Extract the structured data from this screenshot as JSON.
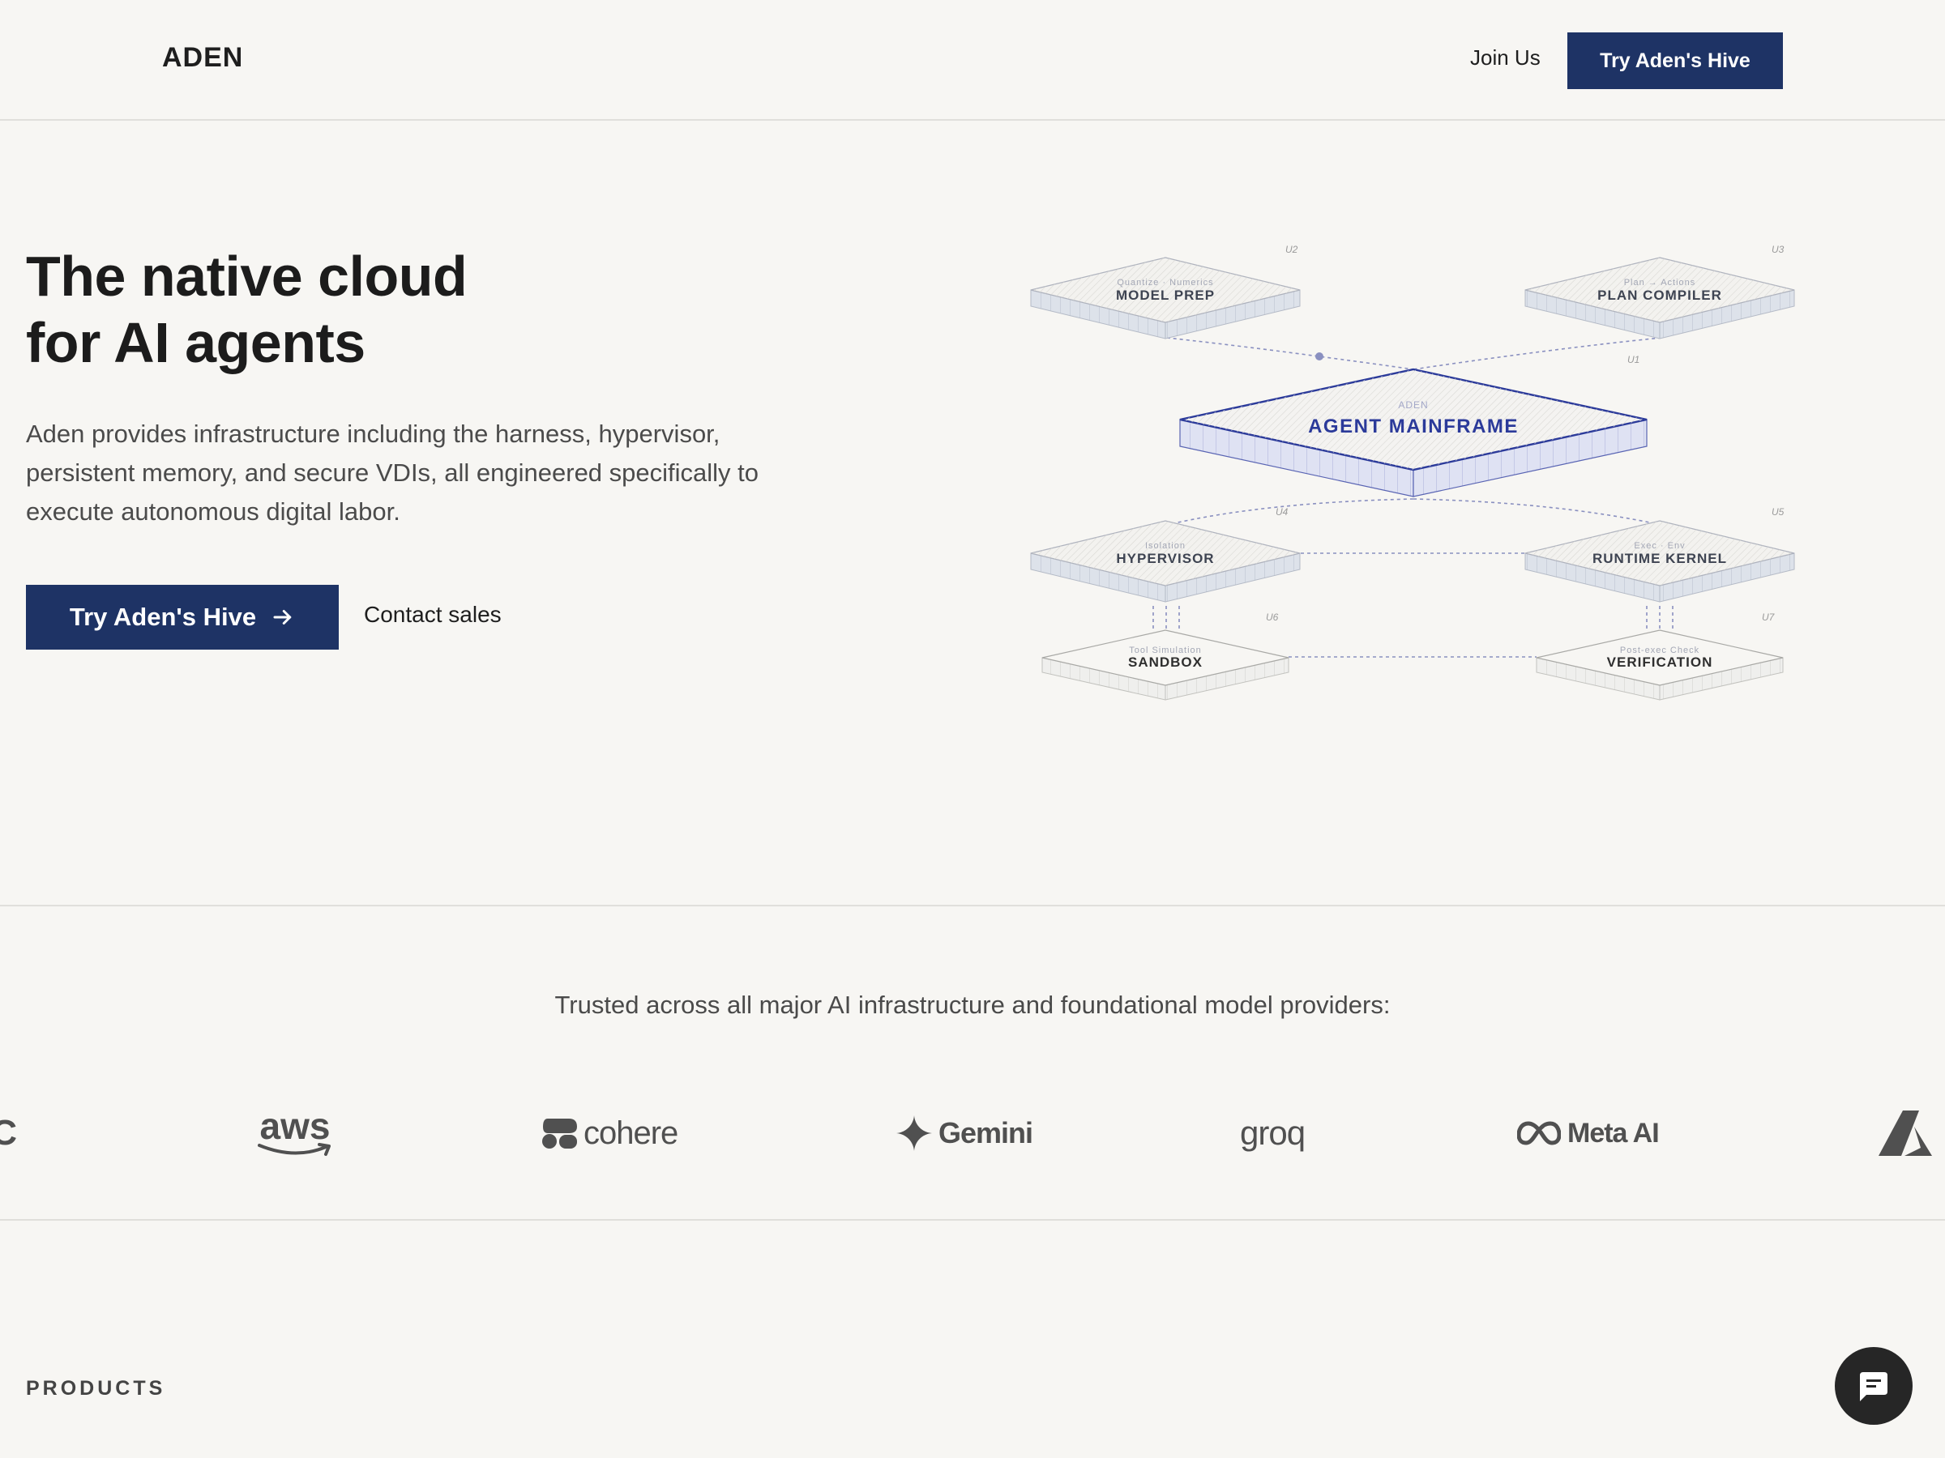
{
  "header": {
    "logo": "ADEN",
    "join_label": "Join Us",
    "cta_label": "Try Aden's Hive"
  },
  "hero": {
    "title_line1": "The native cloud",
    "title_line2": "for AI agents",
    "description": "Aden provides infrastructure including the harness, hypervisor, persistent memory, and secure VDIs, all engineered specifically to execute autonomous digital labor.",
    "cta_label": "Try Aden's Hive",
    "contact_label": "Contact sales"
  },
  "diagram": {
    "mainframe": {
      "tag": "ADEN",
      "label": "AGENT MAINFRAME",
      "unit": "U1"
    },
    "model_prep": {
      "tag": "Quantize · Numerics",
      "label": "MODEL PREP",
      "unit": "U2"
    },
    "plan_compiler": {
      "tag": "Plan → Actions",
      "label": "PLAN COMPILER",
      "unit": "U3"
    },
    "hypervisor": {
      "tag": "Isolation",
      "label": "HYPERVISOR",
      "unit": "U4"
    },
    "runtime_kernel": {
      "tag": "Exec · Env",
      "label": "RUNTIME KERNEL",
      "unit": "U5"
    },
    "sandbox": {
      "tag": "Tool Simulation",
      "label": "SANDBOX",
      "unit": "U6"
    },
    "verification": {
      "tag": "Post-exec Check",
      "label": "VERIFICATION",
      "unit": "U7"
    }
  },
  "trusted": {
    "text": "Trusted across all major AI infrastructure and foundational model providers:",
    "logos": [
      {
        "name": "anthropic",
        "text": "\\C",
        "icon": "anthropic-icon"
      },
      {
        "name": "aws",
        "text": "aws",
        "icon": "amazon-smile-icon"
      },
      {
        "name": "cohere",
        "text": "cohere",
        "icon": "cohere-icon"
      },
      {
        "name": "gemini",
        "text": "Gemini",
        "icon": "gemini-star-icon"
      },
      {
        "name": "groq",
        "text": "groq",
        "icon": "groq-icon"
      },
      {
        "name": "meta-ai",
        "text": "Meta AI",
        "icon": "meta-infinity-icon"
      },
      {
        "name": "azure",
        "text": "",
        "icon": "azure-icon"
      }
    ]
  },
  "products": {
    "label": "PRODUCTS"
  },
  "chat": {
    "icon": "chat-icon"
  },
  "colors": {
    "background": "#f7f6f3",
    "primary": "#1e3365",
    "mainframe_accent": "#2b3a9a",
    "text": "#1c1c1c",
    "muted": "#4b4b4b"
  }
}
